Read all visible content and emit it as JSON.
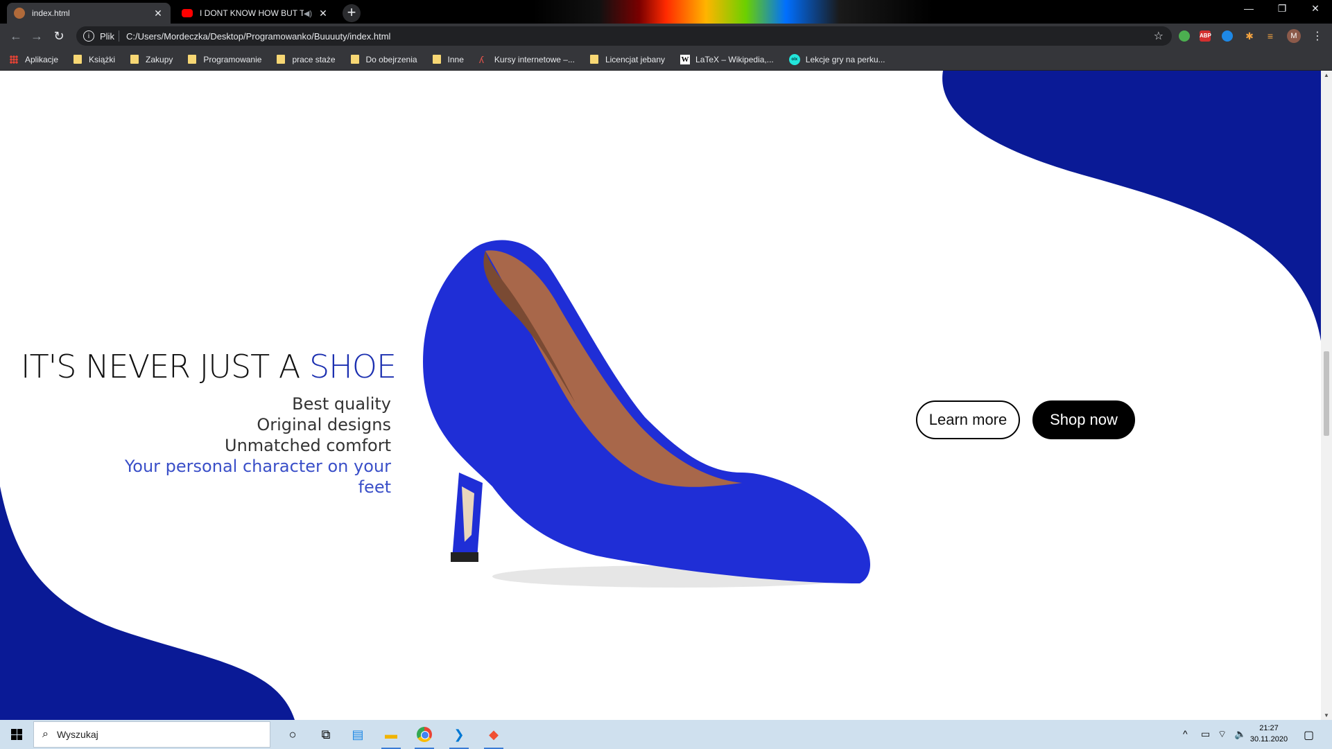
{
  "browser": {
    "tabs": [
      {
        "title": "index.html",
        "active": true
      },
      {
        "title": "I DONT KNOW HOW BUT TH",
        "active": false
      }
    ],
    "new_tab": "+",
    "window_controls": {
      "minimize": "—",
      "restore": "❐",
      "close": "✕"
    },
    "address": {
      "scheme": "Plik",
      "url": "C:/Users/Mordeczka/Desktop/Programowanko/Buuuuty/index.html"
    },
    "profile_initial": "M",
    "extensions": [
      {
        "name": "chrome-ext-icon",
        "label": "",
        "color": "#4caf50"
      },
      {
        "name": "adblock-icon",
        "label": "ABP",
        "color": "#d32f2f"
      },
      {
        "name": "ext-circle-icon",
        "label": "",
        "color": "#1e88e5"
      },
      {
        "name": "puzzle-icon",
        "label": "✱",
        "color": "#f4a340"
      },
      {
        "name": "reading-list-icon",
        "label": "≡",
        "color": "#f4a340"
      }
    ]
  },
  "bookmarks": [
    {
      "label": "Aplikacje",
      "icon": "apps-grid-icon"
    },
    {
      "label": "Książki",
      "icon": "folder-icon"
    },
    {
      "label": "Zakupy",
      "icon": "folder-icon"
    },
    {
      "label": "Programowanie",
      "icon": "folder-icon"
    },
    {
      "label": "prace staże",
      "icon": "folder-icon"
    },
    {
      "label": "Do obejrzenia",
      "icon": "folder-icon"
    },
    {
      "label": "Inne",
      "icon": "folder-icon"
    },
    {
      "label": "Kursy internetowe –...",
      "icon": "linkedin-learning-icon"
    },
    {
      "label": "Licencjat jebany",
      "icon": "folder-icon"
    },
    {
      "label": "LaTeX – Wikipedia,...",
      "icon": "wikipedia-icon"
    },
    {
      "label": "Lekcje gry na perku...",
      "icon": "olx-icon"
    }
  ],
  "page": {
    "headline_main": "IT'S NEVER JUST A ",
    "headline_accent": "SHOE",
    "features": [
      "Best quality",
      "Original designs",
      "Unmatched comfort"
    ],
    "feature_accent": "Your personal character on your feet",
    "learn_more": "Learn more",
    "shop_now": "Shop now",
    "colors": {
      "blob": "#0a1a96",
      "accent_text": "#1b2fb0",
      "shoe": "#1f2ed6"
    }
  },
  "taskbar": {
    "search_placeholder": "Wyszukaj",
    "apps": [
      "cortana-icon",
      "task-view-icon",
      "explorer-doc-icon",
      "file-explorer-icon",
      "chrome-icon",
      "vscode-icon",
      "git-icon"
    ],
    "time": "21:27",
    "date": "30.11.2020"
  }
}
